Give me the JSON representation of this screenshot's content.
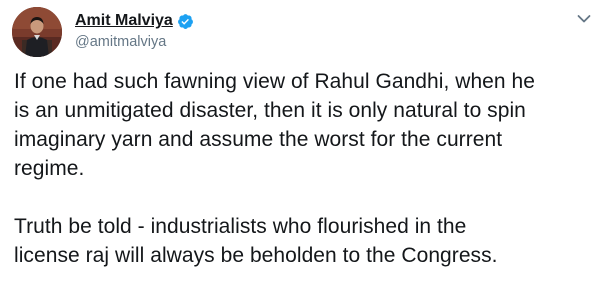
{
  "tweet": {
    "author": {
      "name": "Amit Malviya",
      "handle": "@amitmalviya",
      "verified": true
    },
    "paragraphs": [
      {
        "lines": [
          "If one had such fawning view of Rahul Gandhi, when he",
          "is an unmitigated disaster, then it is only natural to spin",
          "imaginary yarn and assume the worst for the current",
          "regime."
        ]
      },
      {
        "lines": [
          "Truth be told - industrialists who flourished in the",
          "license raj will always be beholden to the Congress."
        ]
      }
    ]
  },
  "icons": {
    "avatar": "profile-photo",
    "verified": "verified-badge-icon",
    "menu": "chevron-down-icon"
  },
  "colors": {
    "text": "#14171a",
    "secondary": "#657786",
    "verified": "#1da1f2"
  }
}
